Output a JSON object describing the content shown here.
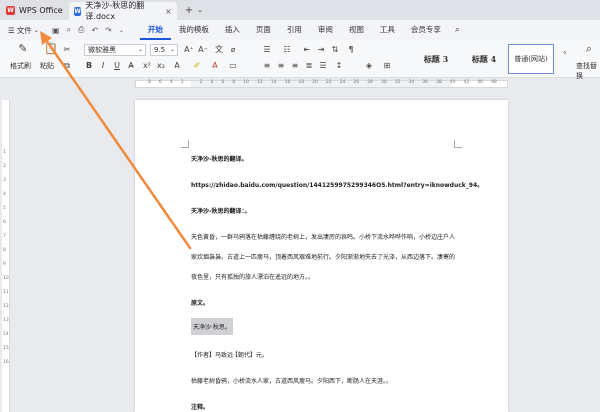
{
  "titlebar": {
    "app_name": "WPS Office",
    "app_logo": "W",
    "doc_tab": "天净沙-秋思的翻译.docx",
    "doc_logo": "W",
    "close": "×",
    "new_tab": "+",
    "tab_menu": "⌄"
  },
  "menubar": {
    "file_label": "文件",
    "tabs": [
      "开始",
      "我的模板",
      "插入",
      "页面",
      "引用",
      "审阅",
      "视图",
      "工具",
      "会员专享"
    ],
    "active_tab": "开始"
  },
  "ribbon": {
    "brush_label": "格式刷",
    "paste_label": "粘贴",
    "font_name": "微软雅黑",
    "font_size": "9.5",
    "styles": [
      "标题 3",
      "标题 4",
      "普通(网站)"
    ],
    "find_label": "查找替换"
  },
  "ruler": {
    "h_numbers": [
      "8",
      "6",
      "4",
      "2",
      "",
      "2",
      "4",
      "6",
      "8",
      "10",
      "12",
      "14",
      "16",
      "18",
      "20",
      "22",
      "24",
      "26",
      "28",
      "30",
      "32",
      "34",
      "36",
      "38",
      "40",
      "42",
      "46",
      "48"
    ],
    "v_numbers": [
      "1",
      "2",
      "3",
      "4",
      "5",
      "6",
      "7",
      "8",
      "9",
      "10",
      "11",
      "12",
      "13",
      "14",
      "15",
      "16"
    ]
  },
  "document": {
    "paragraphs": [
      {
        "text": "天净沙-秋思的翻译。",
        "bold": true
      },
      {
        "text": "https://zhidao.baidu.com/question/1441259975299346O5.html?entry=iknowduck_94。",
        "bold": true
      },
      {
        "text": "天净沙-秋思的翻译：。",
        "bold": true
      },
      {
        "text": "天色黄昏，一群乌鸦落在枯藤缠绕的老树上，发出凄厉的哀鸣。小桥下流水哗哗作响，小桥边庄户人",
        "bold": false
      },
      {
        "text": "家炊烟袅袅。古道上一匹瘦马，顶着西风艰难地前行。夕阳渐渐地失去了光泽，从西边落下。凄寒的",
        "bold": false
      },
      {
        "text": "夜色里，只有孤独的旅人漂泊在遥远的地方。。",
        "bold": false
      },
      {
        "text": "原文。",
        "bold": true
      },
      {
        "text": "天净沙·秋思。",
        "bold": false,
        "highlight": true
      },
      {
        "text": "【作者】马致远·【朝代】元。",
        "bold": false
      },
      {
        "text": "枯藤老树昏鸦，小桥流水人家，古道西风瘦马。夕阳西下，断肠人在天涯。。",
        "bold": false
      },
      {
        "text": "注释。",
        "bold": true
      }
    ]
  },
  "colors": {
    "accent": "#1a56d6",
    "arrow": "#f08a3c",
    "app_logo": "#e03a3a",
    "doc_logo": "#2f6fe0"
  },
  "icons": {
    "brush": "paintbrush-icon",
    "paste": "clipboard-icon",
    "cut": "scissors-icon",
    "copy": "copy-icon",
    "search": "search-icon",
    "save": "save-icon",
    "undo": "undo-icon",
    "redo": "redo-icon",
    "print": "print-icon"
  }
}
